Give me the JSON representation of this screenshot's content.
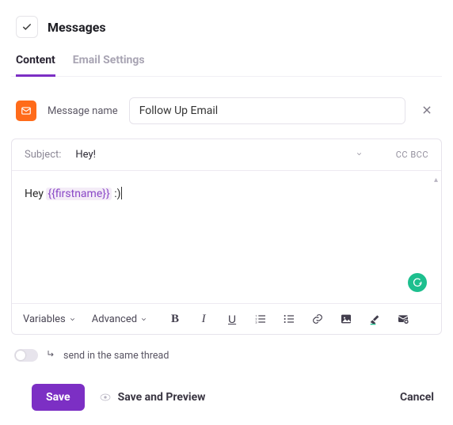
{
  "header": {
    "title": "Messages"
  },
  "tabs": {
    "content": "Content",
    "email_settings": "Email Settings"
  },
  "message_name": {
    "label": "Message name",
    "value": "Follow Up Email"
  },
  "subject": {
    "label": "Subject:",
    "value": "Hey!",
    "cc_bcc": "CC BCC"
  },
  "body": {
    "prefix": "Hey ",
    "token": "{{firstname}}",
    "suffix": " :)"
  },
  "toolbar": {
    "variables": "Variables",
    "advanced": "Advanced"
  },
  "thread": {
    "label": "send in the same thread"
  },
  "footer": {
    "save": "Save",
    "save_preview": "Save and Preview",
    "cancel": "Cancel"
  }
}
